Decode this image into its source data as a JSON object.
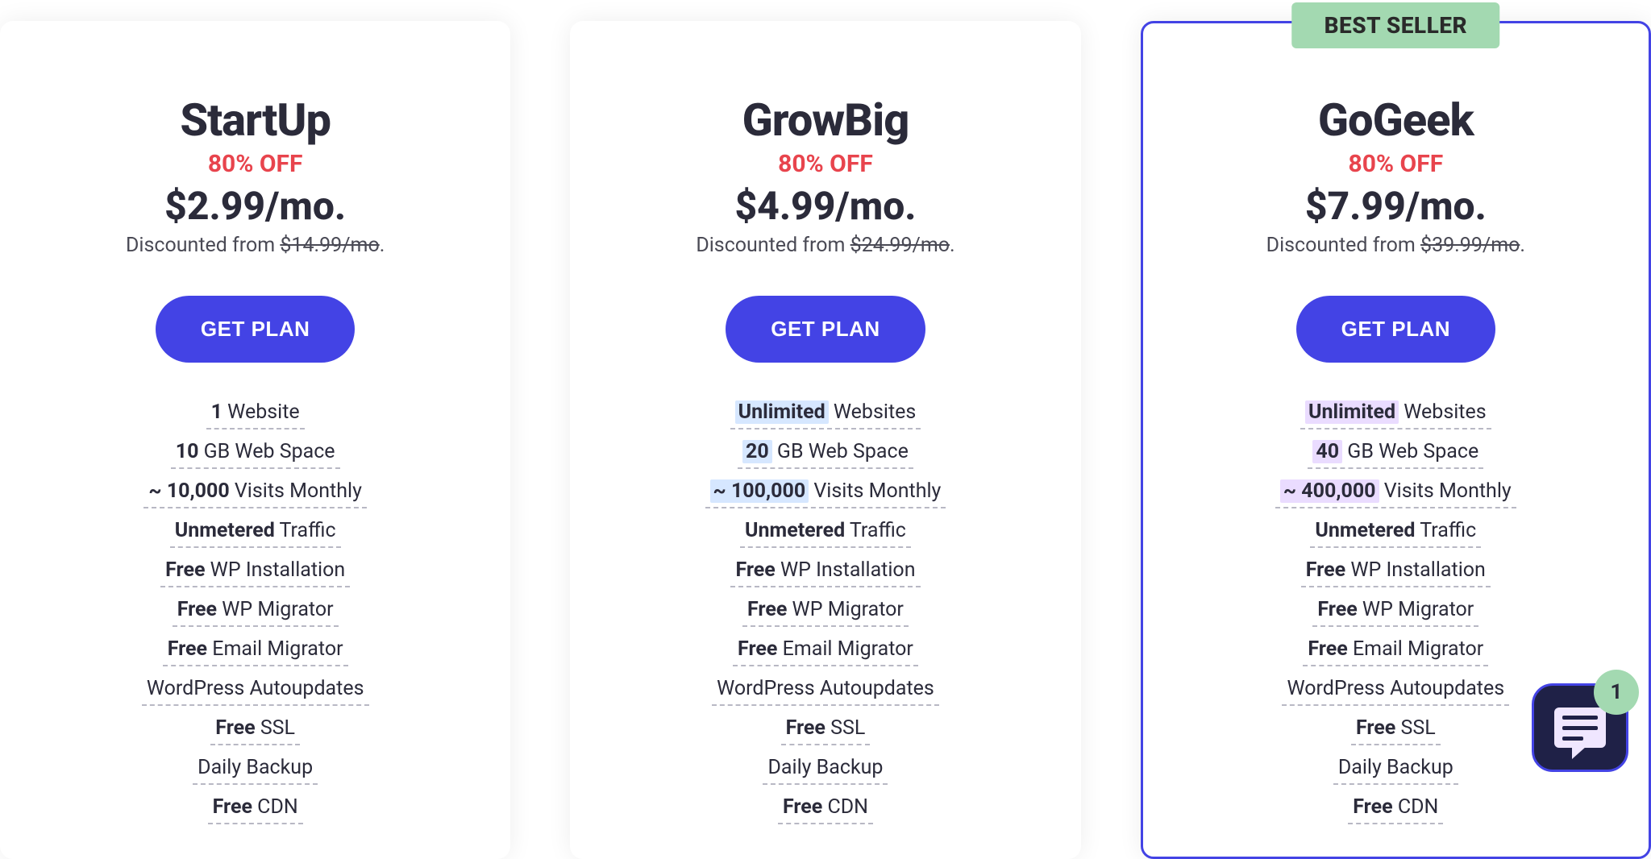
{
  "chat": {
    "unread": "1"
  },
  "common": {
    "cta": "GET PLAN",
    "discounted_prefix": "Discounted from ",
    "discounted_suffix": "."
  },
  "plans": [
    {
      "id": "startup",
      "name": "StartUp",
      "discount": "80% OFF",
      "price": "$2.99/mo.",
      "original": "$14.99/mo",
      "highlight": "",
      "badge": "",
      "features": [
        {
          "bold": "1",
          "rest": " Website"
        },
        {
          "bold": "10",
          "rest": " GB Web Space"
        },
        {
          "bold": "~ 10,000",
          "rest": " Visits Monthly"
        },
        {
          "bold": "Unmetered",
          "rest": " Traffic"
        },
        {
          "bold": "Free",
          "rest": " WP Installation"
        },
        {
          "bold": "Free",
          "rest": " WP Migrator"
        },
        {
          "bold": "Free",
          "rest": " Email Migrator"
        },
        {
          "bold": "",
          "rest": "WordPress Autoupdates"
        },
        {
          "bold": "Free",
          "rest": " SSL"
        },
        {
          "bold": "",
          "rest": "Daily Backup"
        },
        {
          "bold": "Free",
          "rest": " CDN"
        }
      ]
    },
    {
      "id": "growbig",
      "name": "GrowBig",
      "discount": "80% OFF",
      "price": "$4.99/mo.",
      "original": "$24.99/mo",
      "highlight": "blue",
      "badge": "",
      "features": [
        {
          "bold": "Unlimited",
          "rest": " Websites",
          "hl": true
        },
        {
          "bold": "20",
          "rest": " GB Web Space",
          "hl": true
        },
        {
          "bold": "~ 100,000",
          "rest": " Visits Monthly",
          "hl": true
        },
        {
          "bold": "Unmetered",
          "rest": " Traffic"
        },
        {
          "bold": "Free",
          "rest": " WP Installation"
        },
        {
          "bold": "Free",
          "rest": " WP Migrator"
        },
        {
          "bold": "Free",
          "rest": " Email Migrator"
        },
        {
          "bold": "",
          "rest": "WordPress Autoupdates"
        },
        {
          "bold": "Free",
          "rest": " SSL"
        },
        {
          "bold": "",
          "rest": "Daily Backup"
        },
        {
          "bold": "Free",
          "rest": " CDN"
        }
      ]
    },
    {
      "id": "gogeek",
      "name": "GoGeek",
      "discount": "80% OFF",
      "price": "$7.99/mo.",
      "original": "$39.99/mo",
      "highlight": "purple",
      "badge": "BEST SELLER",
      "features": [
        {
          "bold": "Unlimited",
          "rest": " Websites",
          "hl": true
        },
        {
          "bold": "40",
          "rest": " GB Web Space",
          "hl": true
        },
        {
          "bold": "~ 400,000",
          "rest": " Visits Monthly",
          "hl": true
        },
        {
          "bold": "Unmetered",
          "rest": " Traffic"
        },
        {
          "bold": "Free",
          "rest": " WP Installation"
        },
        {
          "bold": "Free",
          "rest": " WP Migrator"
        },
        {
          "bold": "Free",
          "rest": " Email Migrator"
        },
        {
          "bold": "",
          "rest": "WordPress Autoupdates"
        },
        {
          "bold": "Free",
          "rest": " SSL"
        },
        {
          "bold": "",
          "rest": "Daily Backup"
        },
        {
          "bold": "Free",
          "rest": " CDN"
        }
      ]
    }
  ]
}
